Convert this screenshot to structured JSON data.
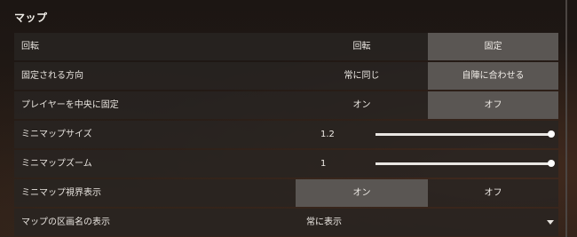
{
  "section_title": "マップ",
  "rows": {
    "rotation": {
      "label": "回転",
      "options": [
        "回転",
        "固定"
      ],
      "selected": "固定"
    },
    "fixed_direction": {
      "label": "固定される方向",
      "options": [
        "常に同じ",
        "自陣に合わせる"
      ],
      "selected": "自陣に合わせる"
    },
    "center_player": {
      "label": "プレイヤーを中央に固定",
      "options": [
        "オン",
        "オフ"
      ],
      "selected": "オフ"
    },
    "minimap_size": {
      "label": "ミニマップサイズ",
      "value": "1.2",
      "slider_fraction": 1.0
    },
    "minimap_zoom": {
      "label": "ミニマップズーム",
      "value": "1",
      "slider_fraction": 1.0
    },
    "minimap_vision": {
      "label": "ミニマップ視界表示",
      "options": [
        "オン",
        "オフ"
      ],
      "selected": "オン"
    },
    "region_names": {
      "label": "マップの区画名の表示",
      "selected_value": "常に表示"
    }
  },
  "colors": {
    "selected_bg": "#5a5653",
    "row_bg": "#2a2624"
  },
  "icons": {
    "dropdown": "chevron-down-icon"
  }
}
